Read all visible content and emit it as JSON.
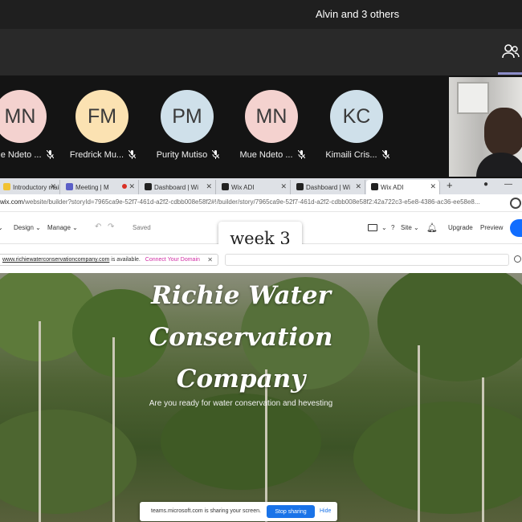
{
  "teams": {
    "meeting_title": "Alvin and 3 others",
    "participants": [
      {
        "initials": "MN",
        "name": "Mue Ndeto ...",
        "color": "#f4d2cf"
      },
      {
        "initials": "FM",
        "name": "Fredrick Mu...",
        "color": "#fbe2b2"
      },
      {
        "initials": "PM",
        "name": "Purity Mutiso",
        "color": "#cfe0ea"
      },
      {
        "initials": "MN",
        "name": "Mue Ndeto ...",
        "color": "#f4d2cf"
      },
      {
        "initials": "KC",
        "name": "Kimaili Cris...",
        "color": "#cfe0ea"
      }
    ]
  },
  "browser": {
    "tabs": [
      {
        "label": "Introductory mail"
      },
      {
        "label": "Meeting | M"
      },
      {
        "label": "Dashboard | Wi"
      },
      {
        "label": "Wix ADI"
      },
      {
        "label": "Dashboard | Wi"
      },
      {
        "label": "Wix ADI"
      }
    ],
    "url_host": "wix.com",
    "url_path": "/website/builder?storyId=7965ca9e-52f7-461d-a2f2-cdbb008e58f2#!/builder/story/7965ca9e-52f7-461d-a2f2-cdbb008e58f2:42a722c3-e5e8-4386-ac36-ee58e8..."
  },
  "wix": {
    "menu_design": "Design",
    "menu_manage": "Manage",
    "saved": "Saved",
    "week_label": "week 3",
    "site": "Site",
    "help": "?",
    "upgrade": "Upgrade",
    "preview": "Preview",
    "domain_link": "www.richiewaterconservationcompany.com",
    "domain_available": "is available.",
    "connect_domain": "Connect Your Domain"
  },
  "hero": {
    "title_line1": "Richie Water",
    "title_line2": "Conservation",
    "title_line3": "Company",
    "subtitle": "Are you ready for water conservation and hevesting"
  },
  "share": {
    "message": "teams.microsoft.com is sharing your screen.",
    "stop": "Stop sharing",
    "hide": "Hide"
  }
}
